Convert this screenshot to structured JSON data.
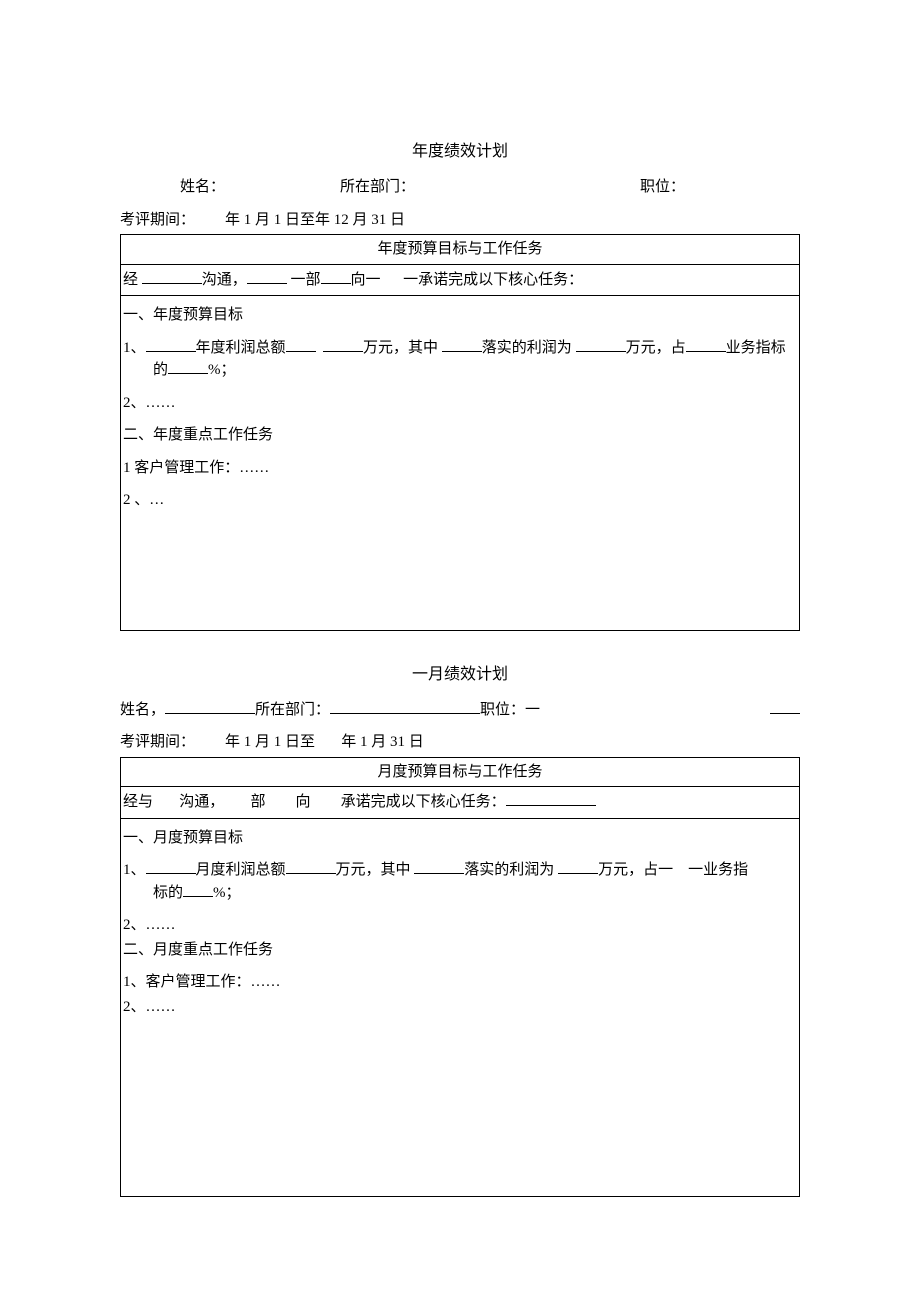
{
  "annual": {
    "title": "年度绩效计划",
    "labels": {
      "name": "姓名：",
      "dept": "所在部门：",
      "pos": "职位：",
      "period_prefix": "考评期间：",
      "period_text": "年 1 月 1 日至年 12 月 31 日"
    },
    "box": {
      "header": "年度预算目标与工作任务",
      "sub_p1": "经 ",
      "sub_p2": "沟通，",
      "sub_p3": " 一部",
      "sub_p4": "向一",
      "sub_p5": "一承诺完成以下核心任务：",
      "s1_title": "一、年度预算目标",
      "s1_l1a": "1、",
      "s1_l1b": "年度利润总额",
      "s1_l1c": "万元，其中 ",
      "s1_l1d": "落实的利润为 ",
      "s1_l1e": "万元，占",
      "s1_l1f": "业务指标",
      "s1_l1g": "的",
      "s1_l1h": "%；",
      "s1_l2": "2、……",
      "s2_title": "二、年度重点工作任务",
      "s2_l1": "1  客户管理工作：……",
      "s2_l2": "2  、…"
    }
  },
  "monthly": {
    "title": "一月绩效计划",
    "labels": {
      "name": "姓名，",
      "dept": "所在部门：",
      "pos": "职位：一",
      "period_prefix": "考评期间：",
      "period_text1": "年 1 月 1 日至",
      "period_text2": "年 1 月 31 日"
    },
    "box": {
      "header": "月度预算目标与工作任务",
      "sub_p1": "经与",
      "sub_p2": "沟通，",
      "sub_p3": "部",
      "sub_p4": "向",
      "sub_p5": "承诺完成以下核心任务：",
      "s1_title": "一、月度预算目标",
      "s1_l1a": "1、",
      "s1_l1b": "月度利润总额",
      "s1_l1c": "万元，其中 ",
      "s1_l1d": "落实的利润为 ",
      "s1_l1e": "万元，占一",
      "s1_l1f": "一业务指",
      "s1_l1g": "标的",
      "s1_l1h": "%；",
      "s1_l2": "2、……",
      "s2_title": "二、月度重点工作任务",
      "s2_l1": "1、客户管理工作：……",
      "s2_l2": "2、……"
    }
  }
}
